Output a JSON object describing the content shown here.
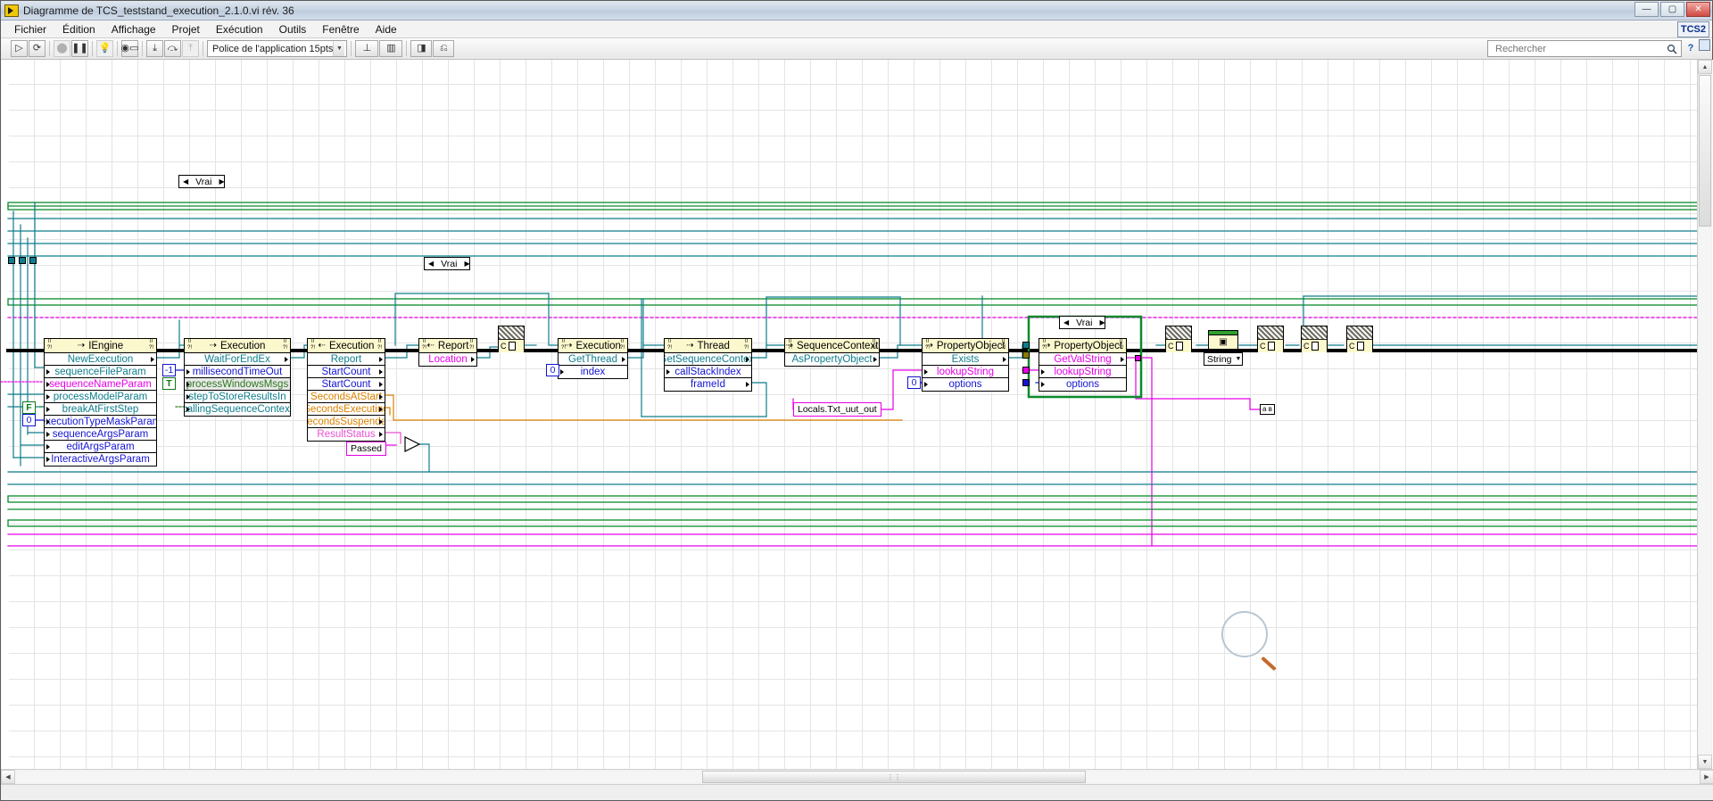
{
  "window": {
    "title": "Diagramme de TCS_teststand_execution_2.1.0.vi rév. 36",
    "logo_icon": "labview-logo-icon",
    "minimize_label": "—",
    "maximize_label": "▢",
    "close_label": "✕"
  },
  "menubar": {
    "items": [
      {
        "label": "Fichier"
      },
      {
        "label": "Édition"
      },
      {
        "label": "Affichage"
      },
      {
        "label": "Projet"
      },
      {
        "label": "Exécution"
      },
      {
        "label": "Outils"
      },
      {
        "label": "Fenêtre"
      },
      {
        "label": "Aide"
      }
    ],
    "badge": "TCS2"
  },
  "toolbar": {
    "run_label": "▷",
    "run_continuous_label": "⟳",
    "abort_label": "⬤",
    "pause_label": "❚❚",
    "highlight_label": "💡",
    "retain_values_label": "◉▭",
    "step_into_label": "⤓",
    "step_over_label": "⤼",
    "step_out_label": "⤒",
    "font_value": "Police de l'application 15pts",
    "font_arrow": "▼",
    "align_label": "⊥",
    "distribute_label": "▥",
    "resize_label": "⬓",
    "reorder_label": "◨",
    "clean_label": "⎌",
    "search_placeholder": "Rechercher",
    "search_value": "",
    "search_icon": "search-icon",
    "help_label": "?",
    "lv_corner_icon": "labview-corner-icon"
  },
  "diagram": {
    "case_structures": [
      {
        "id": "case-top",
        "label": "Vrai",
        "left_arrow": "◀",
        "right_arrow": "▶"
      },
      {
        "id": "case-mid",
        "label": "Vrai",
        "left_arrow": "◀",
        "right_arrow": "▶"
      },
      {
        "id": "case-right",
        "label": "Vrai",
        "left_arrow": "◀",
        "right_arrow": "▶"
      }
    ],
    "nodes": [
      {
        "id": "iengine",
        "title": "IEngine",
        "glyph": "⇢",
        "rows": [
          {
            "text": "NewExecution",
            "color": "teal",
            "lterm": false,
            "rterm": true
          },
          {
            "text": "sequenceFileParam",
            "color": "teal",
            "lterm": true,
            "rterm": false
          },
          {
            "text": "sequenceNameParam",
            "color": "mag",
            "lterm": true,
            "rterm": false
          },
          {
            "text": "processModelParam",
            "color": "teal",
            "lterm": true,
            "rterm": false
          },
          {
            "text": "breakAtFirstStep",
            "color": "green",
            "lterm": true,
            "rterm": false
          },
          {
            "text": "executionTypeMaskParam",
            "color": "blue",
            "lterm": true,
            "rterm": false
          },
          {
            "text": "sequenceArgsParam",
            "color": "blue",
            "lterm": true,
            "rterm": false
          },
          {
            "text": "editArgsParam",
            "color": "blue",
            "lterm": true,
            "rterm": false
          },
          {
            "text": "InteractiveArgsParam",
            "color": "blue",
            "lterm": true,
            "rterm": false
          }
        ]
      },
      {
        "id": "execution-wait",
        "title": "Execution",
        "glyph": "⇢",
        "rows": [
          {
            "text": "WaitForEndEx",
            "color": "teal",
            "lterm": false,
            "rterm": true
          },
          {
            "text": "millisecondTimeOut",
            "color": "blue",
            "lterm": true,
            "rterm": false
          },
          {
            "text": "processWindowsMsgs",
            "color": "green",
            "lterm": true,
            "rterm": false,
            "grey": true
          },
          {
            "text": "stepToStoreResultsIn",
            "color": "teal",
            "lterm": true,
            "rterm": false
          },
          {
            "text": "callingSequenceContext",
            "color": "teal",
            "lterm": true,
            "rterm": false
          }
        ]
      },
      {
        "id": "execution-report",
        "title": "Execution",
        "glyph": "⇠",
        "rows": [
          {
            "text": "Report",
            "color": "teal",
            "lterm": false,
            "rterm": true
          },
          {
            "text": "StartCount",
            "color": "blue",
            "lterm": false,
            "rterm": true
          },
          {
            "text": "StartCount",
            "color": "blue",
            "lterm": false,
            "rterm": true
          },
          {
            "text": "SecondsAtStart",
            "color": "orng",
            "lterm": false,
            "rterm": true
          },
          {
            "text": "SecondsExecuting",
            "color": "orng",
            "lterm": false,
            "rterm": true
          },
          {
            "text": "SecondsSuspended",
            "color": "orng",
            "lterm": false,
            "rterm": true
          },
          {
            "text": "ResultStatus",
            "color": "pink",
            "lterm": false,
            "rterm": true
          }
        ]
      },
      {
        "id": "report-location",
        "title": "Report",
        "glyph": "⇠",
        "rows": [
          {
            "text": "Location",
            "color": "mag",
            "lterm": false,
            "rterm": true
          }
        ]
      },
      {
        "id": "execution-getthread",
        "title": "Execution",
        "glyph": "⇢",
        "rows": [
          {
            "text": "GetThread",
            "color": "teal",
            "lterm": false,
            "rterm": true
          },
          {
            "text": "index",
            "color": "blue",
            "lterm": true,
            "rterm": false
          }
        ]
      },
      {
        "id": "thread-getseqctx",
        "title": "Thread",
        "glyph": "⇢",
        "rows": [
          {
            "text": "GetSequenceContext",
            "color": "teal",
            "lterm": false,
            "rterm": true
          },
          {
            "text": "callStackIndex",
            "color": "blue",
            "lterm": true,
            "rterm": false
          },
          {
            "text": "frameId",
            "color": "blue",
            "lterm": false,
            "rterm": true
          }
        ]
      },
      {
        "id": "seqctx-asprop",
        "title": "SequenceContext",
        "glyph": "⇢",
        "rows": [
          {
            "text": "AsPropertyObject",
            "color": "teal",
            "lterm": false,
            "rterm": true
          }
        ]
      },
      {
        "id": "propobj-exists",
        "title": "PropertyObject",
        "glyph": "⇢",
        "rows": [
          {
            "text": "Exists",
            "color": "teal",
            "lterm": false,
            "rterm": true
          },
          {
            "text": "lookupString",
            "color": "mag",
            "lterm": true,
            "rterm": false
          },
          {
            "text": "options",
            "color": "blue",
            "lterm": true,
            "rterm": false
          }
        ]
      },
      {
        "id": "propobj-getvalstring",
        "title": "PropertyObject",
        "glyph": "⇢",
        "rows": [
          {
            "text": "GetValString",
            "color": "mag",
            "lterm": false,
            "rterm": true
          },
          {
            "text": "lookupString",
            "color": "mag",
            "lterm": true,
            "rterm": false
          },
          {
            "text": "options",
            "color": "blue",
            "lterm": true,
            "rterm": false
          }
        ]
      }
    ],
    "constants": [
      {
        "id": "const-minus-one",
        "value": "-1",
        "style": "blue"
      },
      {
        "id": "const-true-1",
        "value": "T",
        "style": "green"
      },
      {
        "id": "const-false-1",
        "value": "F",
        "style": "green"
      },
      {
        "id": "const-zero-exec",
        "value": "0",
        "style": "blue"
      },
      {
        "id": "const-zero-index",
        "value": "0",
        "style": "blue"
      },
      {
        "id": "const-zero-opts",
        "value": "0",
        "style": "blue"
      }
    ],
    "labels": [
      {
        "id": "label-passed",
        "text": "Passed"
      },
      {
        "id": "label-locals",
        "text": "Locals.Txt_uut_out"
      },
      {
        "id": "label-string",
        "text": "String",
        "arrow": "▼"
      },
      {
        "id": "label-abc",
        "text": "a ʙ"
      }
    ],
    "conversion_nodes": [
      {
        "id": "conv-1",
        "glyph": "%/⌗",
        "sub": "C"
      },
      {
        "id": "conv-2",
        "glyph": "%/⌗",
        "sub": "C"
      },
      {
        "id": "conv-3",
        "glyph": "%/⌗",
        "sub": "C"
      },
      {
        "id": "conv-4",
        "glyph": "%/⌗",
        "sub": "C"
      },
      {
        "id": "conv-5",
        "glyph": "%/⌗",
        "sub": "C"
      }
    ],
    "camera_node": {
      "id": "camera-node",
      "glyph": "▣"
    }
  },
  "scrollbars": {
    "left_arrow": "◀",
    "right_arrow": "▶",
    "up_arrow": "▲",
    "down_arrow": "▼",
    "grip": "⋮⋮"
  }
}
